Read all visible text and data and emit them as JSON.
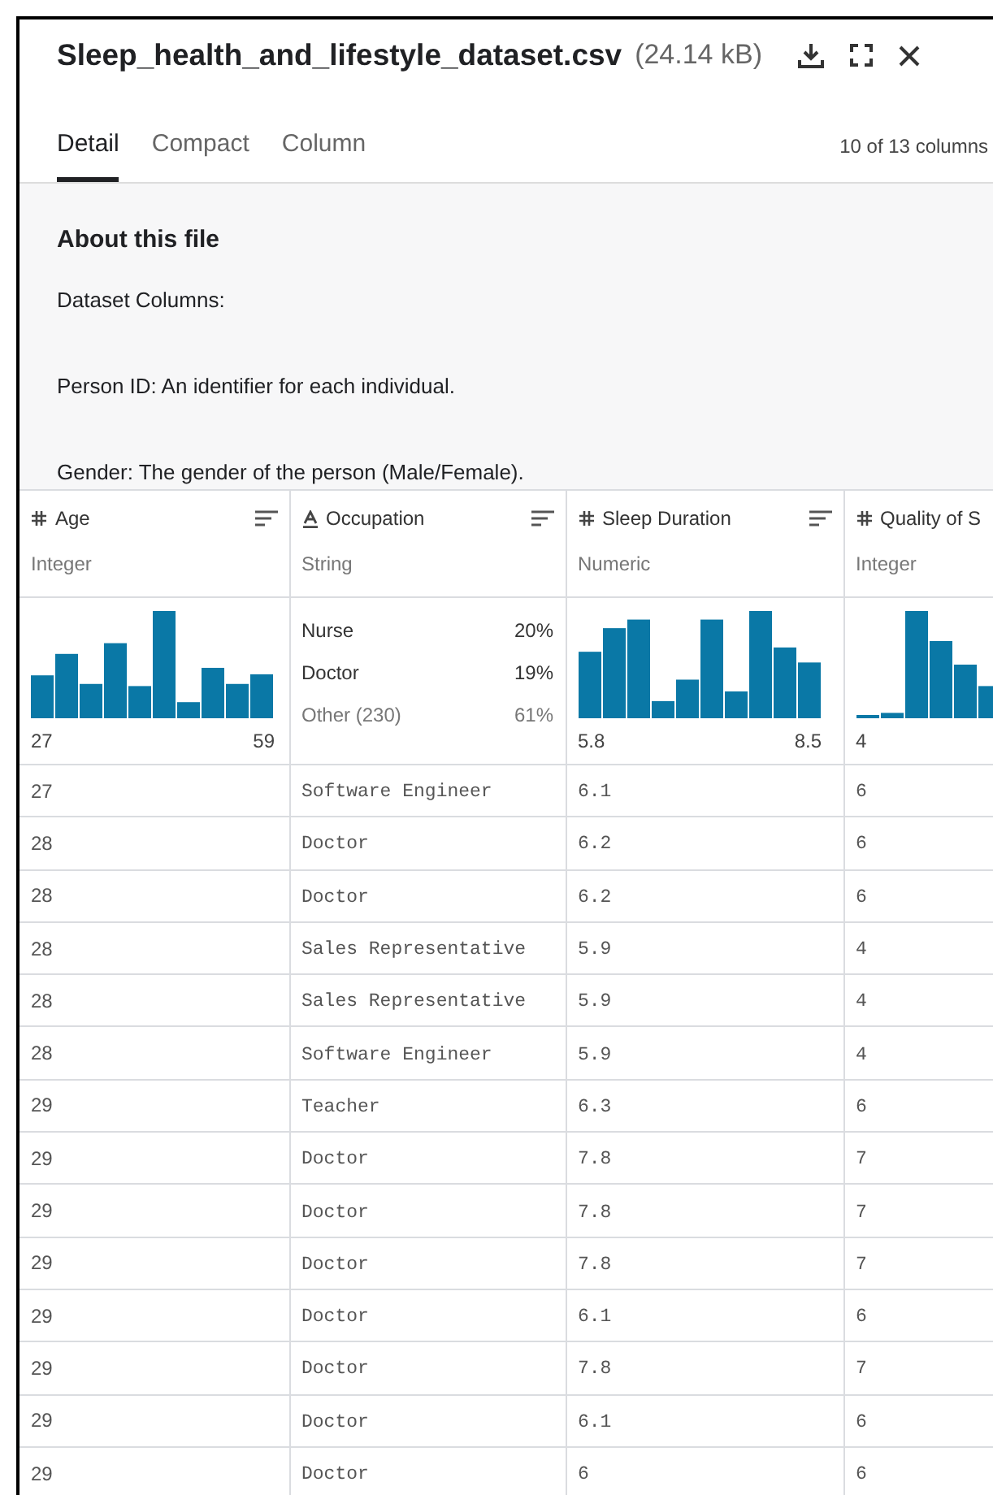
{
  "file": {
    "name": "Sleep_health_and_lifestyle_dataset.csv",
    "size": "(24.14 kB)"
  },
  "tabs": [
    {
      "label": "Detail",
      "selected": true
    },
    {
      "label": "Compact",
      "selected": false
    },
    {
      "label": "Column",
      "selected": false
    }
  ],
  "column_count": "10 of 13 columns",
  "about": {
    "title": "About this file",
    "paragraphs": [
      "Dataset Columns:",
      "Person ID: An identifier for each individual.",
      "Gender: The gender of the person (Male/Female)."
    ]
  },
  "table": {
    "columns": [
      {
        "name": "Age",
        "kind": "numeric",
        "type": "Integer",
        "summary": {
          "kind": "histogram",
          "min": "27",
          "max": "59"
        }
      },
      {
        "name": "Occupation",
        "kind": "string",
        "type": "String",
        "summary": {
          "kind": "categories",
          "items": [
            {
              "label": "Nurse",
              "percent": "20%"
            },
            {
              "label": "Doctor",
              "percent": "19%"
            },
            {
              "label": "Other (230)",
              "percent": "61%"
            }
          ]
        }
      },
      {
        "name": "Sleep Duration",
        "kind": "numeric",
        "type": "Numeric",
        "summary": {
          "kind": "histogram",
          "min": "5.8",
          "max": "8.5"
        }
      },
      {
        "name": "Quality of S",
        "kind": "numeric",
        "type": "Integer",
        "summary": {
          "kind": "histogram",
          "min": "4"
        }
      }
    ],
    "rows": [
      [
        "27",
        "Software Engineer",
        "6.1",
        "6"
      ],
      [
        "28",
        "Doctor",
        "6.2",
        "6"
      ],
      [
        "28",
        "Doctor",
        "6.2",
        "6"
      ],
      [
        "28",
        "Sales Representative",
        "5.9",
        "4"
      ],
      [
        "28",
        "Sales Representative",
        "5.9",
        "4"
      ],
      [
        "28",
        "Software Engineer",
        "5.9",
        "4"
      ],
      [
        "29",
        "Teacher",
        "6.3",
        "6"
      ],
      [
        "29",
        "Doctor",
        "7.8",
        "7"
      ],
      [
        "29",
        "Doctor",
        "7.8",
        "7"
      ],
      [
        "29",
        "Doctor",
        "7.8",
        "7"
      ],
      [
        "29",
        "Doctor",
        "6.1",
        "6"
      ],
      [
        "29",
        "Doctor",
        "7.8",
        "7"
      ],
      [
        "29",
        "Doctor",
        "6.1",
        "6"
      ],
      [
        "29",
        "Doctor",
        "6",
        "6"
      ]
    ]
  }
}
